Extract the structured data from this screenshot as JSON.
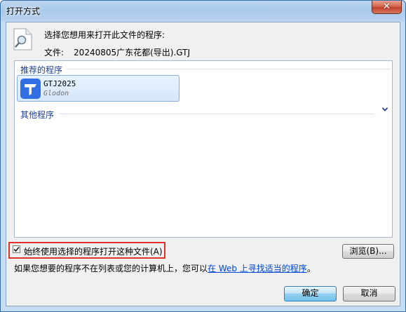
{
  "window": {
    "title": "打开方式",
    "close_glyph": "✕"
  },
  "header": {
    "prompt": "选择您想用来打开此文件的程序:",
    "file_label": "文件:",
    "file_name": "20240805广东花都(导出).GTJ"
  },
  "programs": {
    "recommended_header": "推荐的程序",
    "other_header": "其他程序",
    "items": [
      {
        "name": "GTJ2025",
        "vendor": "Glodon",
        "icon": "glodon-gtj-icon",
        "icon_color": "#2f6fe3"
      }
    ]
  },
  "options": {
    "always_use_label": "始终使用选择的程序打开这种文件(A)",
    "always_use_checked": true
  },
  "buttons": {
    "browse": "浏览(B)...",
    "ok": "确定",
    "cancel": "取消"
  },
  "footer": {
    "text_before": "如果您想要的程序不在列表或您的计算机上，您可以",
    "link_text": "在 Web 上寻找适当的程序",
    "text_after": "。"
  },
  "colors": {
    "highlight_border": "#e0322b",
    "group_header": "#1e3e96",
    "link": "#0046d5"
  }
}
